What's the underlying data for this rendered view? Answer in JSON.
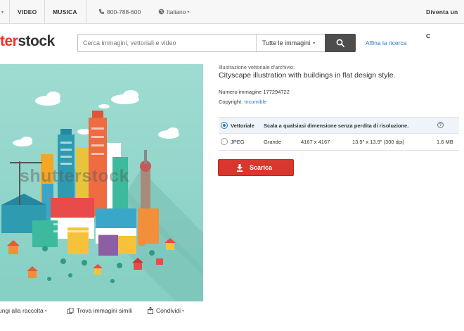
{
  "nav": {
    "video": "VIDEO",
    "music": "MUSICA",
    "phone": "800-788-600",
    "language": "Italiano",
    "signup": "Diventa un C"
  },
  "header": {
    "logo_red": "ter",
    "logo_dark": "stock",
    "search_placeholder": "Cerca immagini, vettoriali e video",
    "search_scope": "Tutte le immagini",
    "refine": "Affina la ricerca"
  },
  "watermark": "shutterstock",
  "details": {
    "label": "Illustrazione vettoriale d'archivio:",
    "title": "Cityscape illustration with buildings in flat design style.",
    "image_number": "Numero immagine 177294722",
    "copyright_label": "Copyright:",
    "copyright_value": "Incomible"
  },
  "options": {
    "vector": {
      "format": "Vettoriale",
      "description": "Scala a qualsiasi dimensione senza perdita di risoluzione.",
      "selected": true
    },
    "jpeg": {
      "format": "JPEG",
      "size": "Grande",
      "pixels": "4167 x 4167",
      "inches": "13.9\" x 13.9\" (300 dpi)",
      "filesize": "1.6 MB",
      "selected": false
    }
  },
  "download_label": "Scarica",
  "actions": {
    "add": "ungi alla raccolta",
    "similar": "Trova immagini simili",
    "share": "Condividi"
  },
  "colors": {
    "brand_red": "#ea3323",
    "button_red": "#d9372d",
    "link_blue": "#2b7bbf",
    "illustration_bg": "#8fd3c8"
  }
}
